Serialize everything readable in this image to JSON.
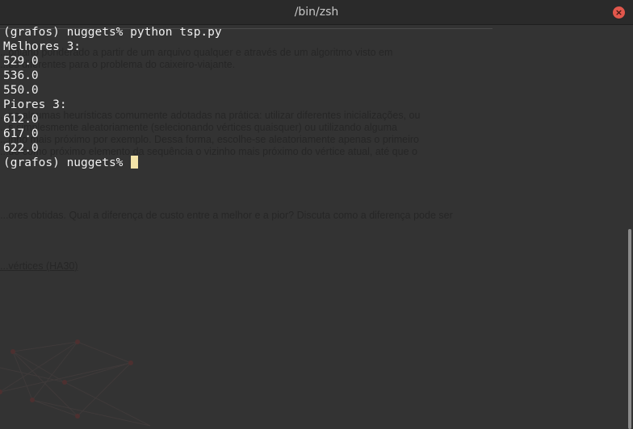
{
  "window": {
    "title": "/bin/zsh",
    "close_symbol": "×"
  },
  "background_text": [
    "...oniano ponderado a partir de um arquivo qualquer e através de um algoritmo visto em",
    "...es diferentes para o problema do caixeiro-viajante.",
    "...na algumas heurísticas comumente adotadas na prática: utilizar diferentes inicializações, ou",
    "...s simplesmente aleatoriamente (selecionando vértices quaisquer) ou utilizando alguma",
    "...inho mais próximo por exemplo. Dessa forma, escolhe-se aleatoriamente apenas o primeiro",
    "...do como próximo elemento da sequência o vizinho mais próximo do vértice atual, até que o",
    "...ores obtidas. Qual a diferença de custo entre a melhor e a pior? Discuta como a diferença pode ser",
    "...vértices (HA30)"
  ],
  "terminal": {
    "lines": [
      "(grafos) nuggets% python tsp.py",
      "Melhores 3:",
      "529.0",
      "536.0",
      "550.0",
      "Piores 3:",
      "612.0",
      "617.0",
      "622.0"
    ],
    "prompt": "(grafos) nuggets% "
  },
  "colors": {
    "terminal_bg": "#333333",
    "text": "#f0f0f0",
    "cursor": "#f3e3a8",
    "close_button": "#e2574c"
  }
}
